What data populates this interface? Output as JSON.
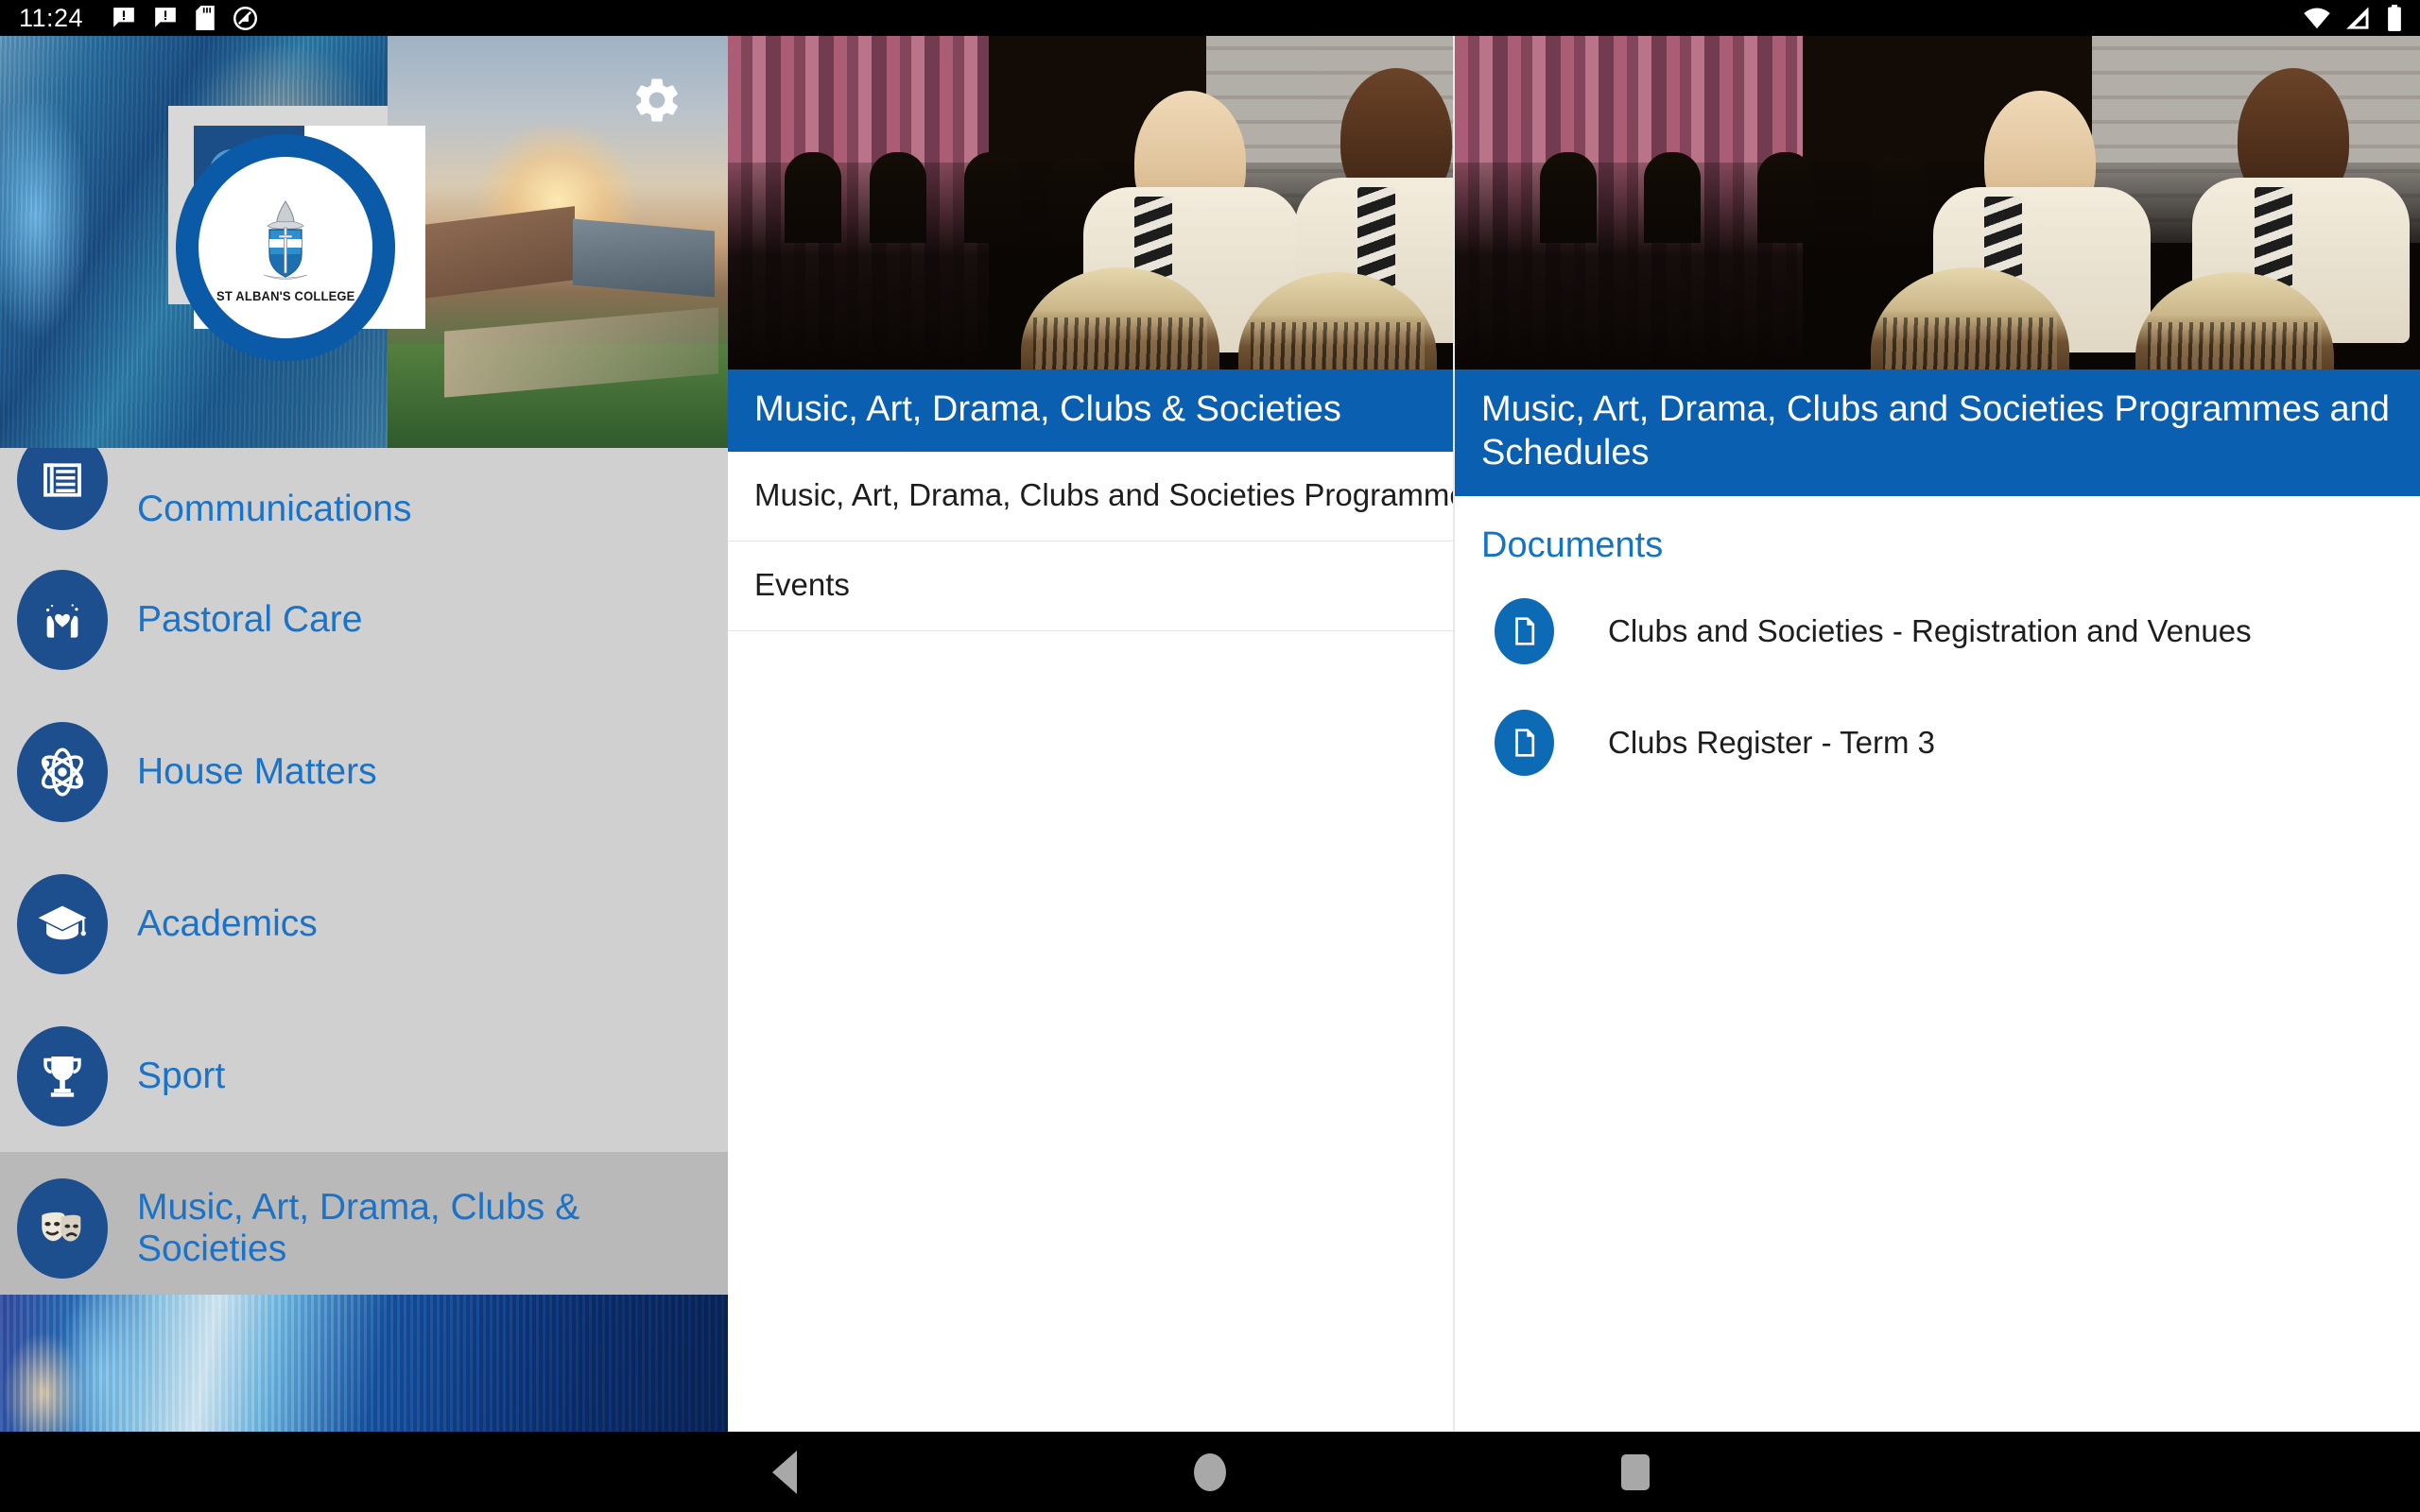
{
  "status_bar": {
    "time": "11:24",
    "left_icons": [
      "message-alert-icon",
      "message-alert-icon",
      "sd-card-icon",
      "do-not-disturb-icon"
    ],
    "right_icons": [
      "wifi-icon",
      "cellular-signal-icon",
      "battery-icon"
    ]
  },
  "app": {
    "logo_name": "ST ALBAN'S COLLEGE",
    "settings_icon": "gear-icon",
    "accent_blue": "#0b5fb0",
    "link_blue": "#1a73c8",
    "icon_blue": "#1d4f8f",
    "sidebar_bg": "#d0d0d0",
    "sidebar_selected_bg": "#b9b9b9"
  },
  "sidebar": {
    "items": [
      {
        "label": "Communications",
        "icon": "newspaper-icon",
        "selected": false,
        "clipped": "top"
      },
      {
        "label": "Pastoral Care",
        "icon": "hands-heart-icon",
        "selected": false,
        "clipped": ""
      },
      {
        "label": "House Matters",
        "icon": "atom-icon",
        "selected": false,
        "clipped": ""
      },
      {
        "label": "Academics",
        "icon": "graduation-cap-icon",
        "selected": false,
        "clipped": ""
      },
      {
        "label": "Sport",
        "icon": "trophy-icon",
        "selected": false,
        "clipped": ""
      },
      {
        "label": "Music, Art, Drama, Clubs & Societies",
        "icon": "theatre-masks-icon",
        "selected": true,
        "clipped": ""
      },
      {
        "label": "",
        "icon": "next-section-icon",
        "selected": false,
        "clipped": "bottom"
      }
    ]
  },
  "middle_panel": {
    "photo": "school-choir-drummers-photo",
    "title": "Music, Art, Drama, Clubs & Societies",
    "rows": [
      {
        "label": "Music, Art, Drama, Clubs and Societies Programmes and Schedules"
      },
      {
        "label": "Events"
      }
    ]
  },
  "right_panel": {
    "photo": "school-choir-drummers-photo",
    "title": "Music, Art, Drama, Clubs and Societies Programmes and Schedules",
    "section_heading": "Documents",
    "documents": [
      {
        "label": "Clubs and Societies - Registration and Venues",
        "icon": "document-file-icon"
      },
      {
        "label": "Clubs Register - Term 3",
        "icon": "document-file-icon"
      }
    ]
  },
  "nav_bar": {
    "back": "back-triangle-icon",
    "home": "home-circle-icon",
    "recents": "recents-square-icon"
  }
}
